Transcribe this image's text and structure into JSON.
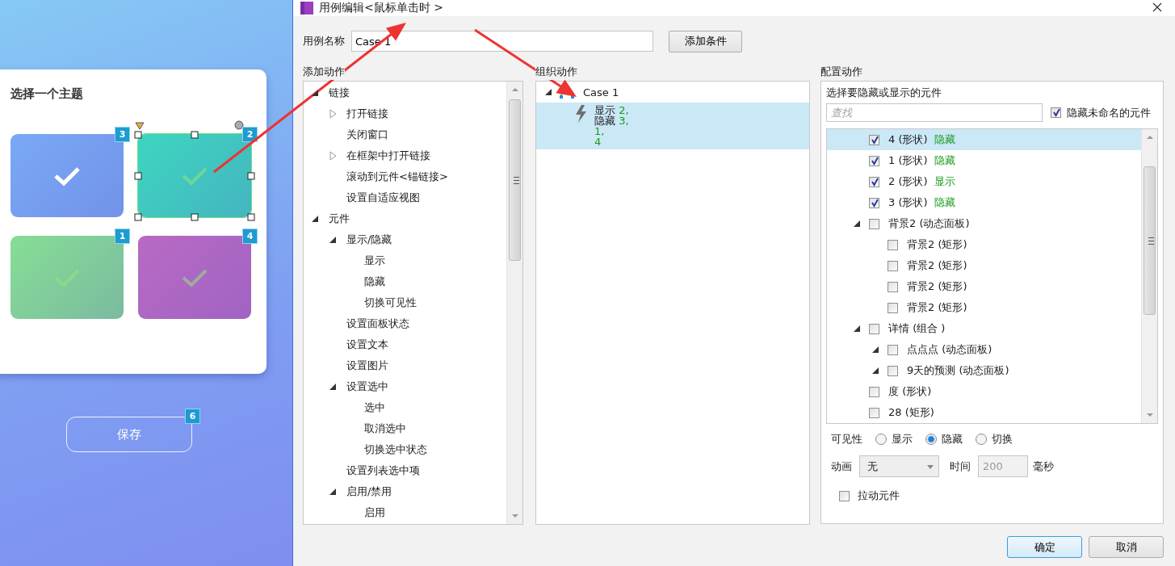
{
  "canvas": {
    "card_title": "选择一个主题",
    "tiles": [
      {
        "badge": "3",
        "color": "#7aa9f6",
        "checked": true,
        "selected": false
      },
      {
        "badge": "2",
        "color": "#3dd6c0",
        "checked": false,
        "selected": true
      },
      {
        "badge": "1",
        "color": "#86de95",
        "checked": false,
        "selected": false
      },
      {
        "badge": "4",
        "color": "#b86ac4",
        "checked": false,
        "selected": false
      }
    ],
    "save_button": {
      "label": "保存",
      "badge": "6"
    }
  },
  "dialog": {
    "title": "用例编辑<鼠标单击时 >",
    "case_name_label": "用例名称",
    "case_name": "Case 1",
    "add_condition_button": "添加条件",
    "add_actions": {
      "heading": "添加动作",
      "tree": [
        {
          "label": "链接",
          "expanded": true,
          "children": [
            {
              "label": "打开链接",
              "expanded": false
            },
            {
              "label": "关闭窗口"
            },
            {
              "label": "在框架中打开链接",
              "expanded": false
            },
            {
              "label": "滚动到元件<锚链接>"
            },
            {
              "label": "设置自适应视图"
            }
          ]
        },
        {
          "label": "元件",
          "expanded": true,
          "children": [
            {
              "label": "显示/隐藏",
              "expanded": true,
              "children": [
                {
                  "label": "显示"
                },
                {
                  "label": "隐藏"
                },
                {
                  "label": "切换可见性"
                }
              ]
            },
            {
              "label": "设置面板状态"
            },
            {
              "label": "设置文本"
            },
            {
              "label": "设置图片"
            },
            {
              "label": "设置选中",
              "expanded": true,
              "children": [
                {
                  "label": "选中"
                },
                {
                  "label": "取消选中"
                },
                {
                  "label": "切换选中状态"
                }
              ]
            },
            {
              "label": "设置列表选中项"
            },
            {
              "label": "启用/禁用",
              "expanded": true,
              "children": [
                {
                  "label": "启用"
                }
              ]
            }
          ]
        }
      ]
    },
    "organize_actions": {
      "heading": "组织动作",
      "cases": [
        {
          "name": "Case 1",
          "expanded": true,
          "actions": [
            {
              "selected": true,
              "lines": [
                {
                  "verb": "显示",
                  "targets": "2,"
                },
                {
                  "verb": "隐藏",
                  "targets": "3,"
                },
                {
                  "targets": "1,"
                },
                {
                  "targets": "4"
                }
              ]
            }
          ]
        }
      ]
    },
    "configure_action": {
      "heading": "配置动作",
      "prompt": "选择要隐藏或显示的元件",
      "search_placeholder": "查找",
      "hide_unnamed": {
        "label": "隐藏未命名的元件",
        "checked": true
      },
      "widgets": [
        {
          "label": "4 (形状)",
          "action": "隐藏",
          "checked": true,
          "selected": true
        },
        {
          "label": "1 (形状)",
          "action": "隐藏",
          "checked": true,
          "selected": false
        },
        {
          "label": "2 (形状)",
          "action": "显示",
          "checked": true,
          "selected": false
        },
        {
          "label": "3 (形状)",
          "action": "隐藏",
          "checked": true,
          "selected": false
        },
        {
          "label": "背景2 (动态面板)",
          "checked": false,
          "selected": false,
          "expanded": true,
          "children": [
            {
              "label": "背景2 (矩形)",
              "checked": false,
              "selected": false
            },
            {
              "label": "背景2 (矩形)",
              "checked": false,
              "selected": false
            },
            {
              "label": "背景2 (矩形)",
              "checked": false,
              "selected": false
            },
            {
              "label": "背景2 (矩形)",
              "checked": false,
              "selected": false
            }
          ]
        },
        {
          "label": "详情 (组合 )",
          "checked": false,
          "selected": false,
          "expanded": true,
          "children": [
            {
              "label": "点点点 (动态面板)",
              "checked": false,
              "selected": false,
              "expanded": true
            },
            {
              "label": "9天的预测 (动态面板)",
              "checked": false,
              "selected": false,
              "expanded": true
            }
          ]
        },
        {
          "label": "度 (形状)",
          "checked": false,
          "selected": false
        },
        {
          "label": "28 (矩形)",
          "checked": false,
          "selected": false
        }
      ],
      "visibility": {
        "label": "可见性",
        "options": [
          {
            "label": "显示",
            "selected": false
          },
          {
            "label": "隐藏",
            "selected": true
          },
          {
            "label": "切换",
            "selected": false
          }
        ]
      },
      "animation": {
        "label": "动画",
        "value": "无"
      },
      "duration": {
        "label": "时间",
        "value": "200",
        "unit": "毫秒"
      },
      "drag_widget": {
        "label": "拉动元件",
        "checked": false
      }
    },
    "buttons": [
      {
        "label": "确定",
        "focused": true
      },
      {
        "label": "取消",
        "focused": false
      }
    ]
  }
}
